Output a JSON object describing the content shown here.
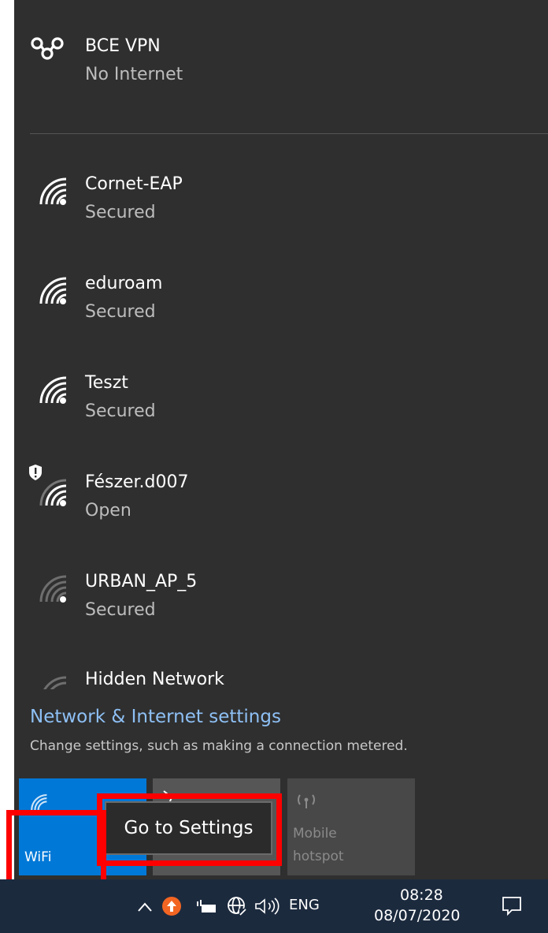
{
  "vpn": {
    "name": "BCE VPN",
    "status": "No Internet"
  },
  "networks": [
    {
      "name": "Cornet-EAP",
      "status": "Secured"
    },
    {
      "name": "eduroam",
      "status": "Secured"
    },
    {
      "name": "Teszt",
      "status": "Secured"
    },
    {
      "name": "Fészer.d007",
      "status": "Open"
    },
    {
      "name": "URBAN_AP_5",
      "status": "Secured"
    },
    {
      "name": "Hidden Network"
    }
  ],
  "settings": {
    "link": "Network & Internet settings",
    "description": "Change settings, such as making a connection metered."
  },
  "quick_actions": {
    "wifi": "WiFi",
    "hotspot_line1": "Mobile",
    "hotspot_line2": "hotspot"
  },
  "tooltip": "Go to Settings",
  "taskbar": {
    "language": "ENG",
    "time": "08:28",
    "date": "08/07/2020"
  },
  "colors": {
    "accent": "#0078d7",
    "highlight": "#ff0000",
    "flyout_bg": "#2f2f2f",
    "taskbar_bg": "#1c2a3e",
    "link": "#8ec0f5"
  }
}
